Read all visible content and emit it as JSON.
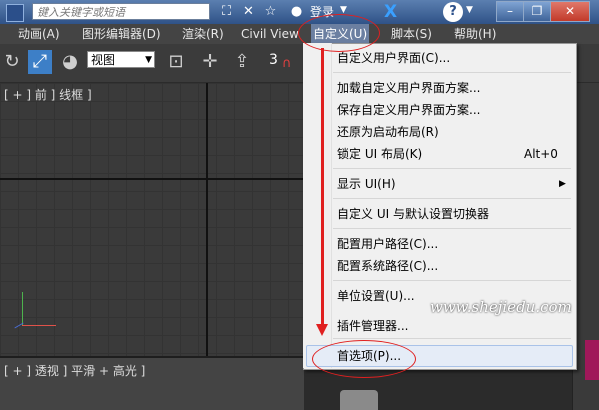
{
  "titlebar": {
    "search_placeholder": "键入关键字或短语",
    "login_label": "登录",
    "help_label": "?",
    "icons": [
      "binoculars-icon",
      "user-search-icon",
      "star-icon",
      "user-icon"
    ]
  },
  "menubar": {
    "items": [
      "动画(A)",
      "图形编辑器(D)",
      "渲染(R)",
      "Civil View",
      "自定义(U)",
      "脚本(S)",
      "帮助(H)"
    ]
  },
  "toolbar": {
    "view_select": "视图",
    "snap_number": "3"
  },
  "viewports": {
    "top_label": "[ + ] 前 ] 线框 ]",
    "bottom_label": "[ + ] 透视 ] 平滑 + 高光 ]"
  },
  "dropdown": {
    "items": [
      {
        "label": "自定义用户界面(C)...",
        "shortcut": ""
      },
      {
        "label": "加载自定义用户界面方案...",
        "shortcut": ""
      },
      {
        "label": "保存自定义用户界面方案...",
        "shortcut": ""
      },
      {
        "label": "还原为启动布局(R)",
        "shortcut": ""
      },
      {
        "label": "锁定 UI 布局(K)",
        "shortcut": "Alt+0"
      },
      {
        "label": "显示 UI(H)",
        "shortcut": ""
      },
      {
        "label": "自定义 UI 与默认设置切换器",
        "shortcut": ""
      },
      {
        "label": "配置用户路径(C)...",
        "shortcut": ""
      },
      {
        "label": "配置系统路径(C)...",
        "shortcut": ""
      },
      {
        "label": "单位设置(U)...",
        "shortcut": ""
      },
      {
        "label": "插件管理器...",
        "shortcut": ""
      },
      {
        "label": "首选项(P)...",
        "shortcut": ""
      }
    ]
  },
  "watermark": "www.shejiedu.com",
  "colors": {
    "menu_highlight": "#6b7fa1",
    "annotation_red": "#e02020",
    "dropdown_bg": "#f0f0f0"
  }
}
